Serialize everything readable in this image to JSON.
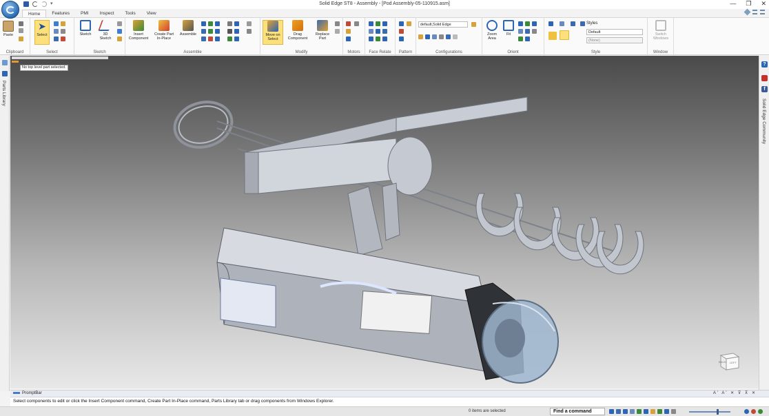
{
  "window": {
    "title": "Solid Edge ST8 - Assembly - [Pod Assembly-05-110915.asm]",
    "controls": [
      "—",
      "❐",
      "✕"
    ]
  },
  "quick_access": {
    "more": "▾"
  },
  "tabs": [
    {
      "label": "Home",
      "active": true
    },
    {
      "label": "Features"
    },
    {
      "label": "PMI"
    },
    {
      "label": "Inspect"
    },
    {
      "label": "Tools"
    },
    {
      "label": "View"
    }
  ],
  "ribbon": {
    "groups": {
      "clipboard": "Clipboard",
      "select": "Select",
      "sketch": "Sketch",
      "assemble": "Assemble",
      "modify": "Modify",
      "motors": "Motors",
      "face_relate": "Face Relate",
      "pattern": "Pattern",
      "configurations": "Configurations",
      "orient": "Orient",
      "style": "Style",
      "window": "Window"
    },
    "buttons": {
      "paste": "Paste",
      "select": "Select",
      "sketch": "Sketch",
      "sketch3d_1": "3D",
      "sketch3d_2": "Sketch",
      "insert_1": "Insert",
      "insert_2": "Component",
      "create_1": "Create Part",
      "create_2": "In-Place",
      "assemble": "Assemble",
      "move_1": "Move on",
      "move_2": "Select",
      "drag_1": "Drag",
      "drag_2": "Component",
      "replace_1": "Replace",
      "replace_2": "Part",
      "zoom_1": "Zoom",
      "zoom_2": "Area",
      "fit": "Fit",
      "switch_1": "Switch",
      "switch_2": "Windows"
    },
    "configurations_value": "default,Solid Edge",
    "styles_label": "Styles",
    "style_value": "Default",
    "style_none": "(None)"
  },
  "left_panel": {
    "label": "Parts Library"
  },
  "right_panel": {
    "label": "Solid Edge Community"
  },
  "viewport": {
    "status_message": "No top level part selected.",
    "viewcube_labels": {
      "back": "BACK",
      "left": "LEFT"
    }
  },
  "prompt_bar": {
    "title": "PromptBar",
    "controls": "A' A' ✕ ⊽ ⊼ ✕",
    "message": "Select components to edit or click the Insert Component command, Create Part In-Place command, Parts Library tab or drag components from Windows Explorer."
  },
  "status_bar": {
    "selection": "0 items are selected",
    "find_command": "Find a command"
  },
  "colors": {
    "accent_blue": "#2a6db3",
    "highlight": "#fbe07c",
    "part_grey": "#c9ced6",
    "glass": "#9fb6cf"
  }
}
